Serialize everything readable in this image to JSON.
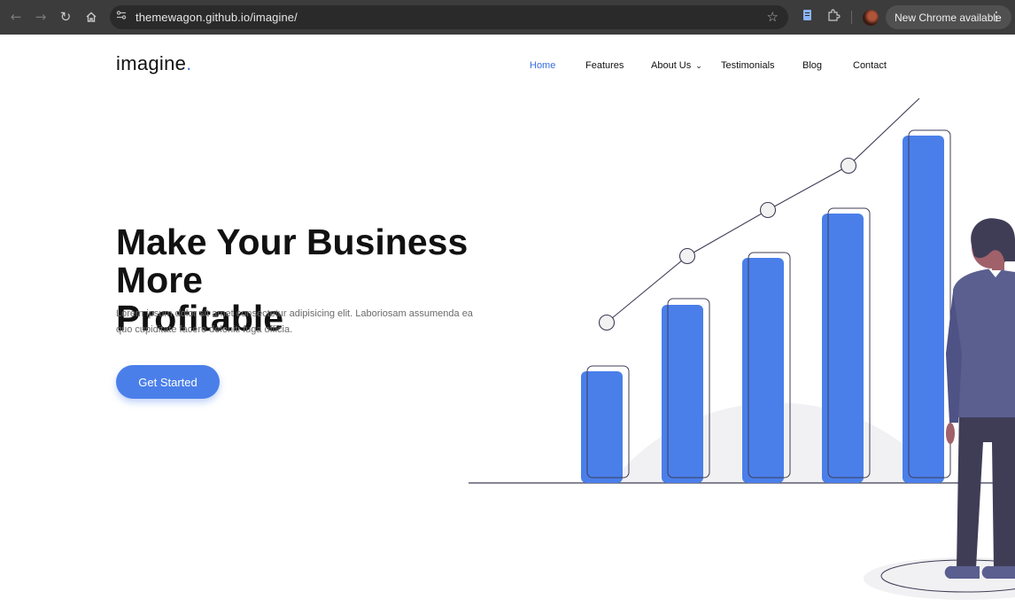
{
  "browser": {
    "url": "themewagon.github.io/imagine/",
    "update_label": "New Chrome available",
    "icons": {
      "back": "back-arrow-icon",
      "forward": "forward-arrow-icon",
      "reload": "reload-icon",
      "home": "home-icon",
      "site_info": "site-settings-icon",
      "bookmark": "star-icon",
      "extension_page": "page-icon",
      "extensions": "puzzle-icon",
      "menu": "kebab-menu-icon"
    }
  },
  "header": {
    "logo_text": "imagine",
    "logo_dot": ".",
    "nav": [
      {
        "label": "Home",
        "active": true
      },
      {
        "label": "Features",
        "active": false
      },
      {
        "label": "About Us",
        "active": false,
        "has_dropdown": true
      },
      {
        "label": "Testimonials",
        "active": false
      },
      {
        "label": "Blog",
        "active": false
      },
      {
        "label": "Contact",
        "active": false
      }
    ]
  },
  "hero": {
    "title_line1": "Make Your Business More",
    "title_line2": "Profitable",
    "description": "Lorem ipsum dolor sit amet consectetur adipisicing elit. Laboriosam assumenda ea quo cupiditate facere deleniti fuga officia.",
    "cta_label": "Get Started"
  },
  "colors": {
    "accent": "#4a7fea",
    "text": "#111111",
    "muted": "#6b6b6b",
    "chrome_bg": "#3c3c3c"
  }
}
